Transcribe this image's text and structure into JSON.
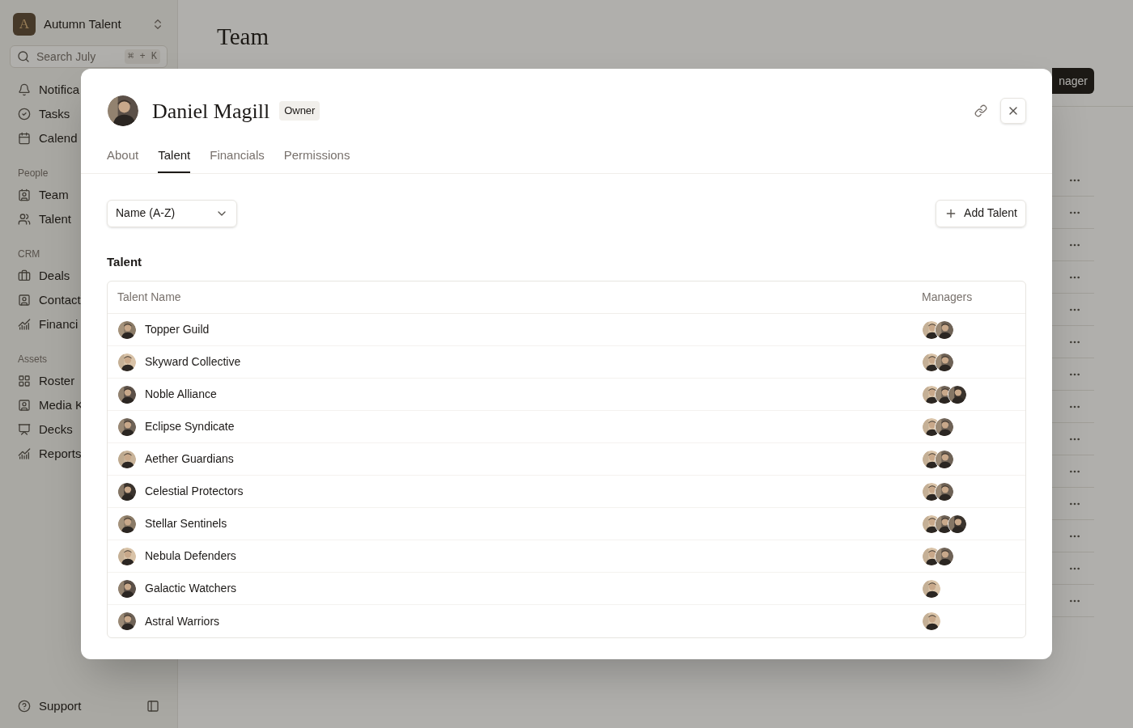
{
  "sidebar": {
    "workspace": {
      "logo_letter": "A",
      "name": "Autumn Talent"
    },
    "search": {
      "placeholder": "Search July",
      "shortcut": "⌘ + K"
    },
    "groups": [
      {
        "items": [
          {
            "label": "Notifica"
          },
          {
            "label": "Tasks"
          },
          {
            "label": "Calend"
          }
        ]
      },
      {
        "title": "People",
        "items": [
          {
            "label": "Team"
          },
          {
            "label": "Talent"
          }
        ]
      },
      {
        "title": "CRM",
        "items": [
          {
            "label": "Deals"
          },
          {
            "label": "Contact"
          },
          {
            "label": "Financi"
          }
        ]
      },
      {
        "title": "Assets",
        "items": [
          {
            "label": "Roster"
          },
          {
            "label": "Media K"
          },
          {
            "label": "Decks"
          },
          {
            "label": "Reports"
          }
        ]
      }
    ],
    "support": "Support"
  },
  "page": {
    "title": "Team",
    "button": "nager"
  },
  "dialog": {
    "name": "Daniel Magill",
    "role": "Owner",
    "tabs": [
      {
        "label": "About",
        "selected": false
      },
      {
        "label": "Talent",
        "selected": true
      },
      {
        "label": "Financials",
        "selected": false
      },
      {
        "label": "Permissions",
        "selected": false
      }
    ],
    "sort": {
      "value": "Name (A-Z)"
    },
    "add_button": "Add Talent",
    "section_title": "Talent",
    "table": {
      "columns": [
        "Talent Name",
        "Managers"
      ],
      "rows": [
        {
          "name": "Topper Guild"
        },
        {
          "name": "Skyward Collective"
        },
        {
          "name": "Noble Alliance"
        },
        {
          "name": "Eclipse Syndicate"
        },
        {
          "name": "Aether Guardians"
        },
        {
          "name": "Celestial Protectors"
        },
        {
          "name": "Stellar Sentinels"
        },
        {
          "name": "Nebula Defenders"
        },
        {
          "name": "Galactic Watchers"
        },
        {
          "name": "Astral Warriors"
        }
      ]
    }
  }
}
